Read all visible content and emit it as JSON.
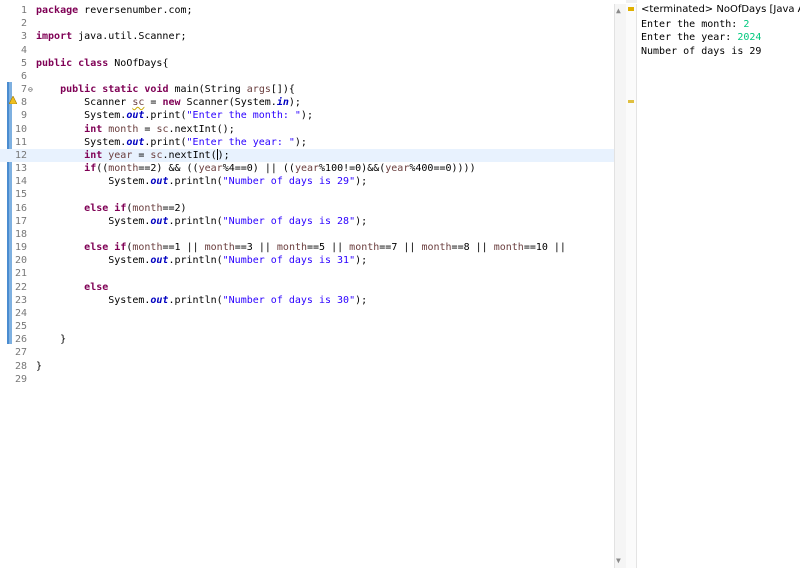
{
  "editor": {
    "lines": [
      {
        "n": "1",
        "t": "package reversenumber.com;"
      },
      {
        "n": "2",
        "t": ""
      },
      {
        "n": "3",
        "t": "import java.util.Scanner;"
      },
      {
        "n": "4",
        "t": ""
      },
      {
        "n": "5",
        "t": "public class NoOfDays{"
      },
      {
        "n": "6",
        "t": ""
      },
      {
        "n": "7",
        "t": "    public static void main(String args[]){"
      },
      {
        "n": "8",
        "t": "        Scanner sc = new Scanner(System.in);"
      },
      {
        "n": "9",
        "t": "        System.out.print(\"Enter the month: \");"
      },
      {
        "n": "10",
        "t": "        int month = sc.nextInt();"
      },
      {
        "n": "11",
        "t": "        System.out.print(\"Enter the year: \");"
      },
      {
        "n": "12",
        "t": "        int year = sc.nextInt();"
      },
      {
        "n": "13",
        "t": "        if((month==2) && ((year%4==0) || ((year%100!=0)&&(year%400==0))))"
      },
      {
        "n": "14",
        "t": "            System.out.println(\"Number of days is 29\");"
      },
      {
        "n": "15",
        "t": ""
      },
      {
        "n": "16",
        "t": "        else if(month==2)"
      },
      {
        "n": "17",
        "t": "            System.out.println(\"Number of days is 28\");"
      },
      {
        "n": "18",
        "t": ""
      },
      {
        "n": "19",
        "t": "        else if(month==1 || month==3 || month==5 || month==7 || month==8 || month==10 ||"
      },
      {
        "n": "20",
        "t": "            System.out.println(\"Number of days is 31\");"
      },
      {
        "n": "21",
        "t": ""
      },
      {
        "n": "22",
        "t": "        else"
      },
      {
        "n": "23",
        "t": "            System.out.println(\"Number of days is 30\");"
      },
      {
        "n": "24",
        "t": ""
      },
      {
        "n": "25",
        "t": ""
      },
      {
        "n": "26",
        "t": "    }"
      },
      {
        "n": "27",
        "t": ""
      },
      {
        "n": "28",
        "t": "}"
      },
      {
        "n": "29",
        "t": ""
      }
    ],
    "current_line": "12",
    "fold_marker": "⊖"
  },
  "console": {
    "title": "<terminated> NoOfDays [Java Appli",
    "lines": [
      {
        "prompt": "Enter the month: ",
        "input": "2"
      },
      {
        "prompt": "Enter the year: ",
        "input": "2024"
      },
      {
        "prompt": "Number of days is 29",
        "input": ""
      }
    ]
  },
  "scroll": {
    "up": "▲",
    "down": "▼"
  },
  "colors": {
    "keyword": "#7f0055",
    "string": "#2a00ff",
    "field": "#0000c0",
    "user_input": "#00c87d",
    "current_line": "#e8f2fe"
  }
}
